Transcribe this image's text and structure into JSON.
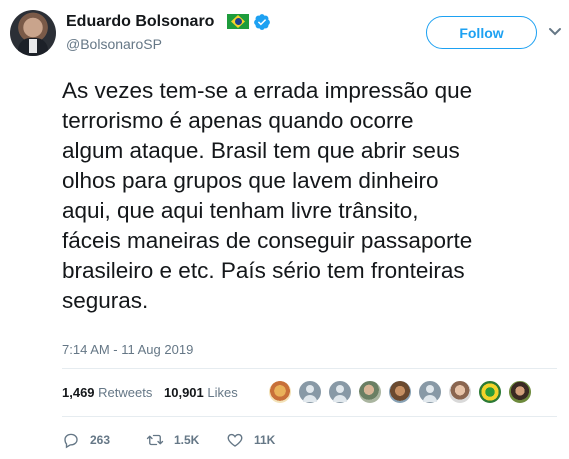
{
  "author": {
    "name": "Eduardo Bolsonaro",
    "handle": "@BolsonaroSP",
    "flag_icon": "brazil-flag-icon",
    "verified_icon": "verified-badge-icon"
  },
  "header": {
    "follow_label": "Follow",
    "menu_icon": "chevron-down-icon"
  },
  "tweet": {
    "lines": [
      "As vezes tem-se a errada impressão que",
      "terrorismo é apenas quando ocorre",
      "algum ataque. Brasil tem que abrir seus",
      "olhos para grupos que lavem dinheiro",
      "aqui, que aqui tenham livre trânsito,",
      "fáceis maneiras de conseguir passaporte",
      "brasileiro e etc. País sério tem fronteiras",
      "seguras."
    ],
    "timestamp": "7:14 AM - 11 Aug 2019"
  },
  "stats": {
    "retweets_count": "1,469",
    "retweets_label": "Retweets",
    "likes_count": "10,901",
    "likes_label": "Likes"
  },
  "actions": {
    "reply_count": "263",
    "retweet_count": "1.5K",
    "like_count": "11K"
  },
  "colors": {
    "accent": "#1da1f2",
    "muted": "#657786",
    "text": "#14171a",
    "divider": "#e6ecf0"
  }
}
